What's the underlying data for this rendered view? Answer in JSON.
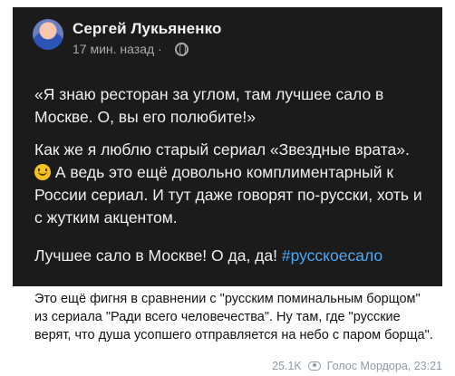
{
  "post": {
    "author": "Сергей Лукьяненко",
    "time": "17 мин. назад ·",
    "paragraph1": "«Я знаю ресторан за углом, там лучшее сало в Москве. О, вы его полюбите!»",
    "paragraph2_before": "Как же я люблю старый сериал «Звездные врата».",
    "paragraph2_after": "А ведь это ещё довольно комплиментарный к России сериал. И тут даже говорят по-русски, хоть и с жутким акцентом.",
    "paragraph3_text": "Лучшее сало в Москве! О да, да! ",
    "hashtag": "#русскоесало"
  },
  "message": {
    "caption": "Это ещё фигня в сравнении с \"русским поминальным борщом\" из сериала \"Ради всего человечества\". Ну там, где \"русские верят, что душа усопшего отправляется на небо с паром борща\".",
    "views": "25.1K",
    "channel": "Голос Мордора, 23:21"
  },
  "icons": {
    "emoji": "smiling-face",
    "privacy": "globe-icon",
    "views": "eye-icon"
  }
}
